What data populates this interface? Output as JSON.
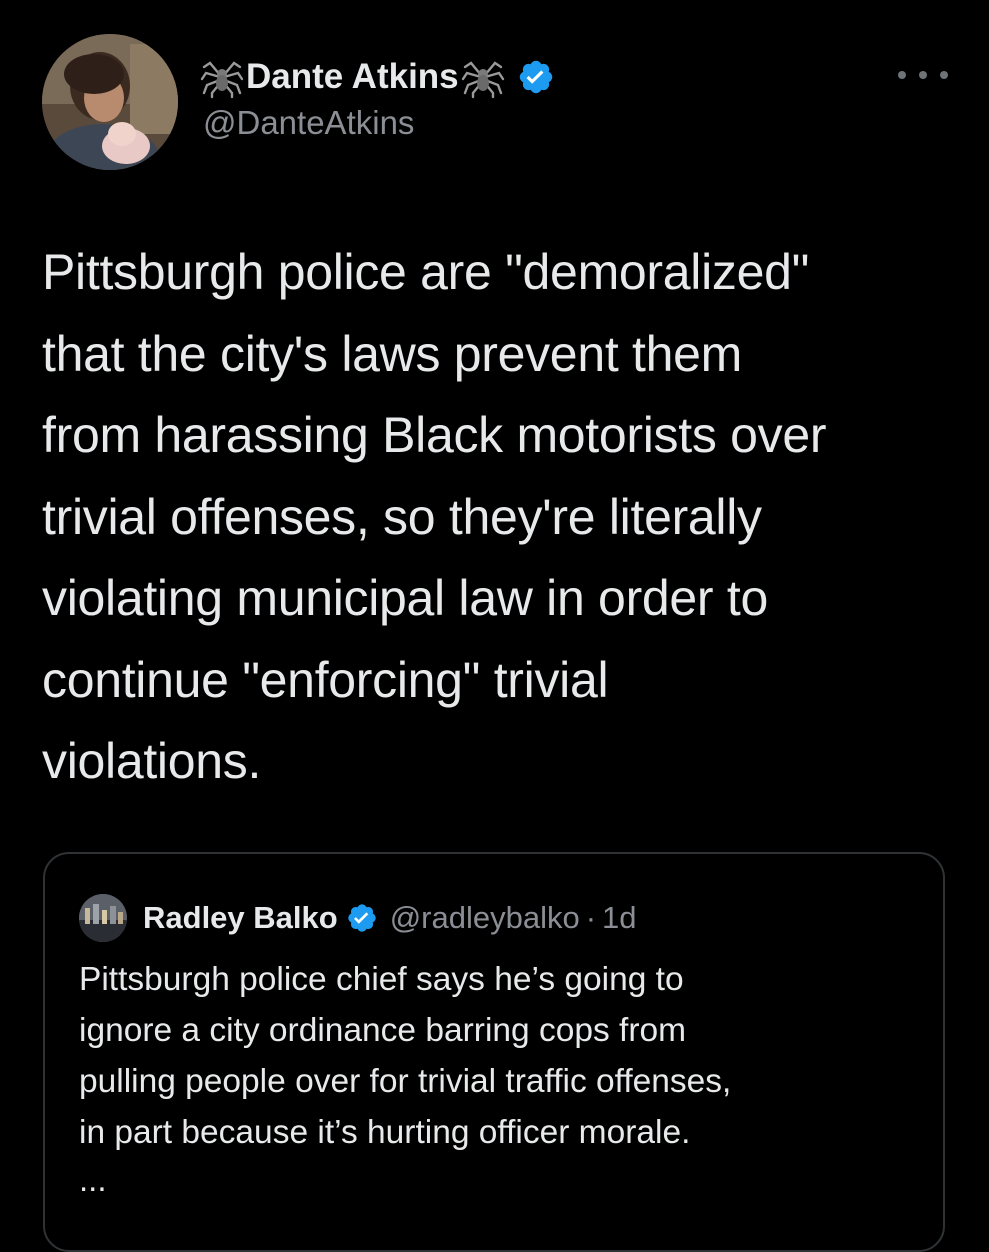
{
  "tweet": {
    "author": {
      "name": "Dante Atkins",
      "handle": "@DanteAtkins",
      "name_decoration": "spider-emoji",
      "verified": true
    },
    "text": "Pittsburgh police are \"demoralized\"\nthat the city's laws prevent them\nfrom harassing Black motorists over\ntrivial offenses, so they're literally\nviolating municipal law in order to\ncontinue \"enforcing\" trivial\nviolations.",
    "more_icon": "more-horizontal-icon"
  },
  "quoted_tweet": {
    "author": {
      "name": "Radley Balko",
      "handle": "@radleybalko",
      "verified": true
    },
    "separator": "·",
    "time": "1d",
    "text": "Pittsburgh police chief says he’s going to\nignore a city ordinance barring cops from\npulling people over for trivial traffic offenses,\nin part because it’s hurting officer morale.",
    "truncation": "..."
  },
  "colors": {
    "background": "#000000",
    "text_primary": "#e7e9ea",
    "text_secondary": "#8b8f95",
    "verified_blue": "#1d9bf0",
    "border": "#2f3336"
  }
}
